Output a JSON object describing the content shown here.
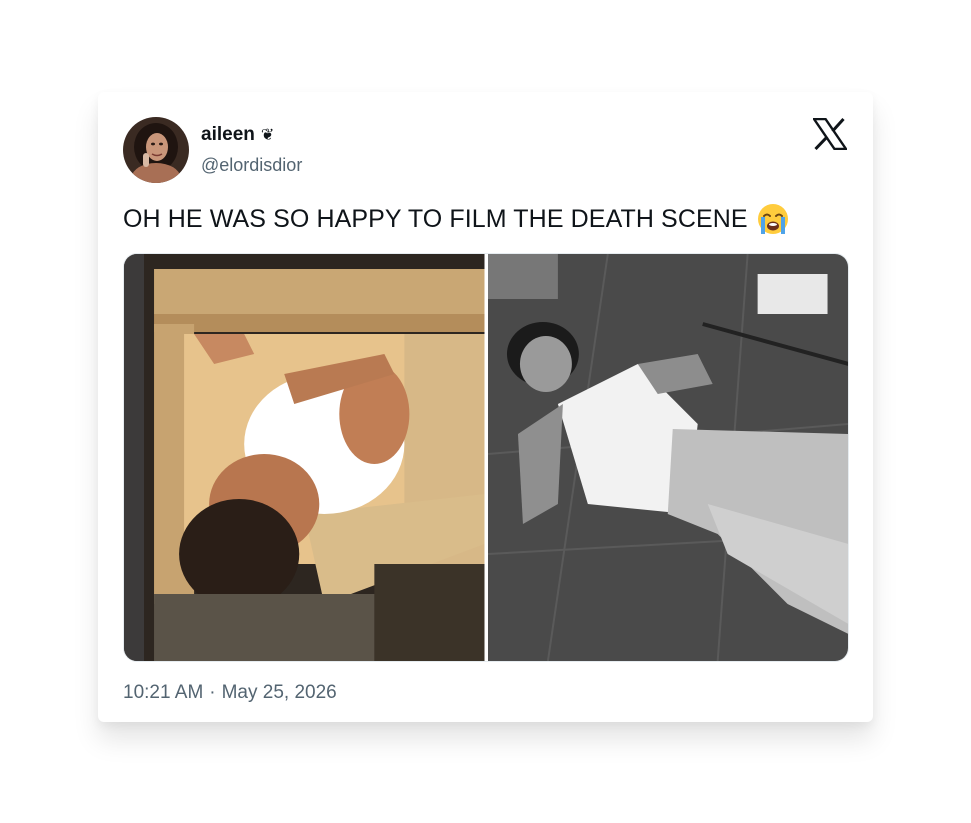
{
  "tweet": {
    "display_name": "aileen",
    "name_symbol": "❦",
    "handle": "@elordisdior",
    "text": "OH HE WAS SO HAPPY TO FILM THE DEATH SCENE",
    "emoji": "loudly-crying-face",
    "time": "10:21 AM",
    "separator": "·",
    "date": "May 25, 2026"
  },
  "icons": {
    "platform_logo": "x-logo-icon"
  },
  "colors": {
    "text_primary": "#0f1419",
    "text_secondary": "#536471",
    "card_background": "#ffffff"
  }
}
